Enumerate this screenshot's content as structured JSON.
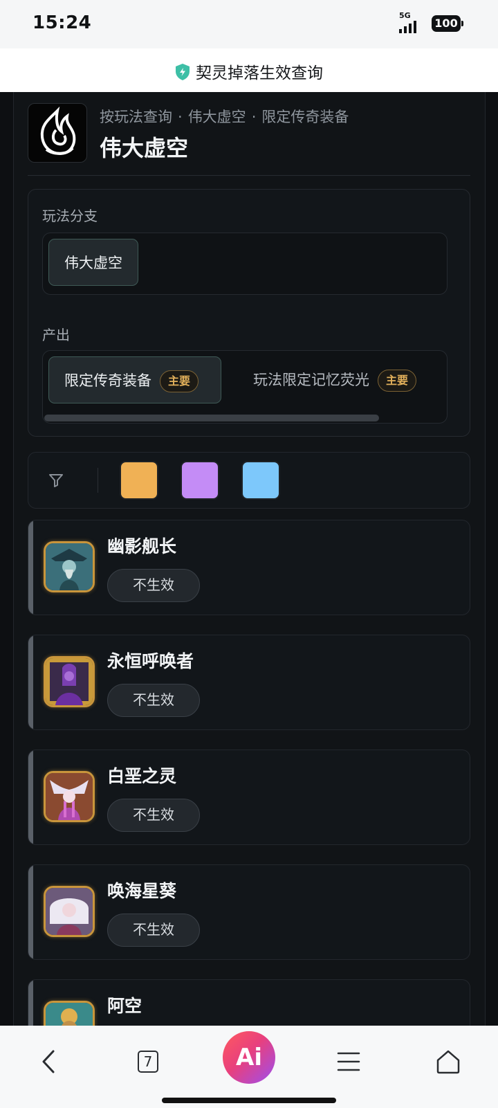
{
  "status_bar": {
    "time": "15:24",
    "network": "5G",
    "battery": "100"
  },
  "title_bar": {
    "title": "契灵掉落生效查询",
    "icon": "shield-check-icon",
    "icon_color": "#3dbfa6"
  },
  "header": {
    "breadcrumb": [
      "按玩法查询",
      "伟大虚空",
      "限定传奇装备"
    ],
    "breadcrumb_separator": "·",
    "title": "伟大虚空",
    "logo_icon": "flame-emblem-icon"
  },
  "branch_section": {
    "label": "玩法分支",
    "options": [
      {
        "label": "伟大虚空",
        "selected": true
      }
    ]
  },
  "output_section": {
    "label": "产出",
    "options": [
      {
        "label": "限定传奇装备",
        "badge": "主要",
        "selected": true
      },
      {
        "label": "玩法限定记忆荧光",
        "badge": "主要",
        "selected": false
      }
    ]
  },
  "filter": {
    "icon": "filter-icon",
    "colors": [
      "#f0b155",
      "#c48cf6",
      "#7dc8fb"
    ]
  },
  "cards": [
    {
      "name": "幽影舰长",
      "status": "不生效",
      "avatar_icon": "ghost-captain-portrait"
    },
    {
      "name": "永恒呼唤者",
      "status": "不生效",
      "avatar_icon": "eternal-caller-portrait"
    },
    {
      "name": "白垩之灵",
      "status": "不生效",
      "avatar_icon": "chalk-spirit-portrait"
    },
    {
      "name": "唤海星葵",
      "status": "不生效",
      "avatar_icon": "sea-star-portrait"
    },
    {
      "name": "阿空",
      "status": "",
      "avatar_icon": "akong-portrait"
    }
  ],
  "bottom_nav": {
    "tab_count": "7",
    "ai_label": "Ai",
    "items": [
      "back-icon",
      "tabs-icon",
      "ai-assistant-button",
      "menu-icon",
      "home-icon"
    ]
  }
}
